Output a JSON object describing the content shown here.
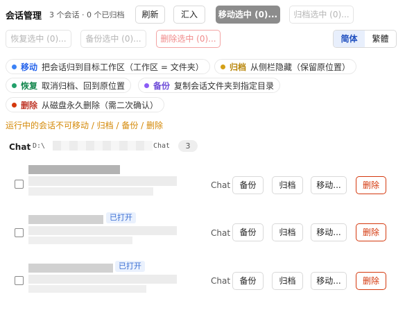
{
  "header": {
    "title": "会话管理",
    "stats": "3 个会话 · 0 个已归档",
    "refresh_label": "刷新",
    "import_label": "汇入",
    "move_selected_label": "移动选中 (0)...",
    "archive_selected_label": "归档选中 (0)...",
    "restore_selected_label": "恢复选中 (0)...",
    "backup_selected_label": "备份选中 (0)...",
    "delete_selected_label": "删除选中 (0)..."
  },
  "language": {
    "simplified_label": "简体",
    "traditional_label": "繁體",
    "selected": "简体"
  },
  "legend": [
    {
      "key": "移动",
      "text": "把会话归到目标工作区（工作区 = 文件夹）",
      "color": "#3b82f6"
    },
    {
      "key": "归档",
      "text": "从侧栏隐藏（保留原位置）",
      "color": "#d4a017"
    },
    {
      "key": "恢复",
      "text": "取消归档、回到原位置",
      "color": "#22a06b"
    },
    {
      "key": "备份",
      "text": "复制会话文件夹到指定目录",
      "color": "#8b5cf6"
    },
    {
      "key": "删除",
      "text": "从磁盘永久删除（需二次确认）",
      "color": "#d4380d"
    }
  ],
  "warning": "运行中的会话不可移动 / 归档 / 备份 / 删除",
  "group": {
    "title": "Chat",
    "path_prefix": "D:\\",
    "path_suffix": "Chat",
    "count": "3"
  },
  "sessions": [
    {
      "badge": "",
      "type": "Chat",
      "backup_label": "备份",
      "archive_label": "归档",
      "move_label": "移动...",
      "delete_label": "删除"
    },
    {
      "badge": "已打开",
      "type": "Chat",
      "backup_label": "备份",
      "archive_label": "归档",
      "move_label": "移动...",
      "delete_label": "删除"
    },
    {
      "badge": "已打开",
      "type": "Chat",
      "backup_label": "备份",
      "archive_label": "归档",
      "move_label": "移动...",
      "delete_label": "删除"
    }
  ],
  "colors": {
    "accent_blue": "#1f4fbf",
    "warning": "#d48806",
    "danger": "#d4380d"
  }
}
